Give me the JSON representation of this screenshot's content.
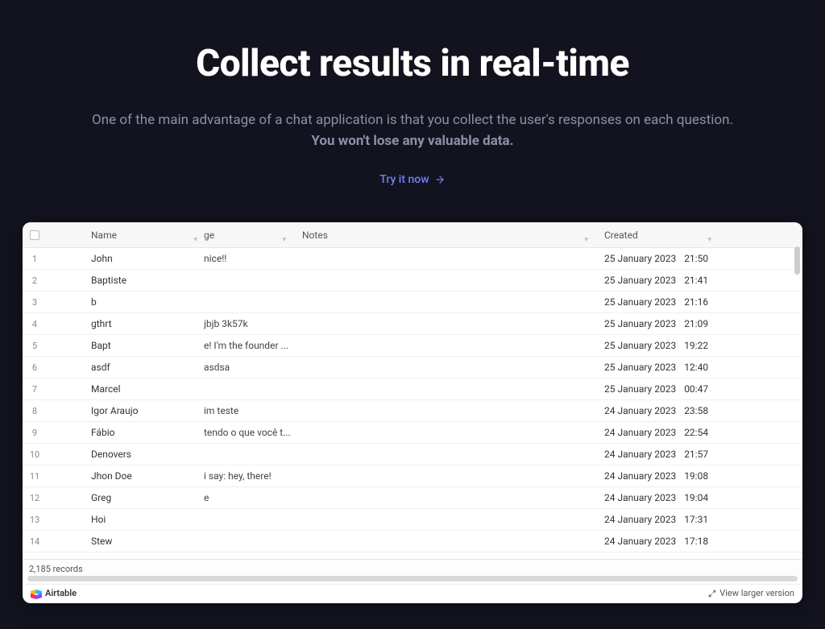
{
  "hero": {
    "title": "Collect results in real-time",
    "subtitle": "One of the main advantage of a chat application is that you collect the user's responses on each question.",
    "subtitle_bold": "You won't lose any valuable data.",
    "cta": "Try it now"
  },
  "table": {
    "headers": {
      "name": "Name",
      "age_fragment": "ge",
      "notes": "Notes",
      "created": "Created"
    },
    "rows": [
      {
        "idx": "1",
        "name": "John",
        "age": "nice!!",
        "notes": "",
        "date": "25 January 2023",
        "time": "21:50"
      },
      {
        "idx": "2",
        "name": "Baptiste",
        "age": "",
        "notes": "",
        "date": "25 January 2023",
        "time": "21:41"
      },
      {
        "idx": "3",
        "name": "b",
        "age": "",
        "notes": "",
        "date": "25 January 2023",
        "time": "21:16"
      },
      {
        "idx": "4",
        "name": "gthrt",
        "age": "jbjb 3k57k",
        "notes": "",
        "date": "25 January 2023",
        "time": "21:09"
      },
      {
        "idx": "5",
        "name": "Bapt",
        "age": "e! I'm the founder ...",
        "notes": "",
        "date": "25 January 2023",
        "time": "19:22"
      },
      {
        "idx": "6",
        "name": "asdf",
        "age": "asdsa",
        "notes": "",
        "date": "25 January 2023",
        "time": "12:40"
      },
      {
        "idx": "7",
        "name": "Marcel",
        "age": "",
        "notes": "",
        "date": "25 January 2023",
        "time": "00:47"
      },
      {
        "idx": "8",
        "name": "Igor Araujo",
        "age": "im teste",
        "notes": "",
        "date": "24 January 2023",
        "time": "23:58"
      },
      {
        "idx": "9",
        "name": "Fábio",
        "age": "tendo o que você t...",
        "notes": "",
        "date": "24 January 2023",
        "time": "22:54"
      },
      {
        "idx": "10",
        "name": "Denovers",
        "age": "",
        "notes": "",
        "date": "24 January 2023",
        "time": "21:57"
      },
      {
        "idx": "11",
        "name": "Jhon Doe",
        "age": "i say: hey, there!",
        "notes": "",
        "date": "24 January 2023",
        "time": "19:08"
      },
      {
        "idx": "12",
        "name": "Greg",
        "age": "e",
        "notes": "",
        "date": "24 January 2023",
        "time": "19:04"
      },
      {
        "idx": "13",
        "name": "Hoi",
        "age": "",
        "notes": "",
        "date": "24 January 2023",
        "time": "17:31"
      },
      {
        "idx": "14",
        "name": "Stew",
        "age": "",
        "notes": "",
        "date": "24 January 2023",
        "time": "17:18"
      }
    ],
    "record_count": "2,185 records",
    "brand": "Airtable",
    "view_larger": "View larger version"
  }
}
